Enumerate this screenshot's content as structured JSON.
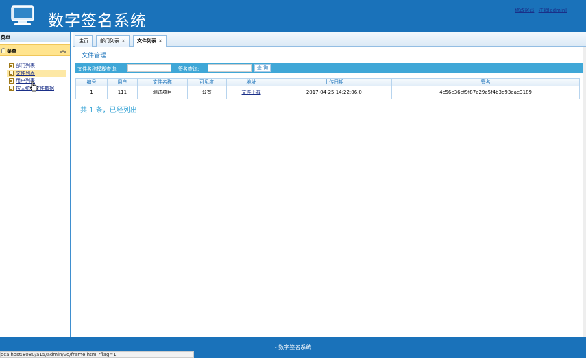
{
  "header": {
    "title": "数字签名系统",
    "links": [
      "修改密码",
      "注销[admin]"
    ]
  },
  "sidebar": {
    "top_label": "菜单",
    "group_label": "菜单",
    "items": [
      {
        "label": "部门列表",
        "active": false
      },
      {
        "label": "文件列表",
        "active": true
      },
      {
        "label": "用户列表",
        "active": false
      },
      {
        "label": "按天统计文件数据",
        "active": false
      }
    ],
    "icons": {
      "group": "lightbulb-icon",
      "collapse": "chevron-up-icon",
      "item": "document-icon"
    }
  },
  "tabs": [
    {
      "label": "主页",
      "closable": false
    },
    {
      "label": "部门列表",
      "closable": true
    },
    {
      "label": "文件列表",
      "closable": true,
      "active": true
    }
  ],
  "main": {
    "section_title": "文件管理",
    "search": {
      "file_label": "文件名称模糊查询:",
      "file_value": "",
      "sign_label": "签名查询:",
      "sign_value": "",
      "button": "查 询"
    },
    "table": {
      "headers": [
        "编号",
        "用户",
        "文件名称",
        "可见度",
        "地址",
        "上传日期",
        "签名"
      ],
      "rows": [
        [
          "1",
          "111",
          "测试项目",
          "公有",
          "文件下载",
          "2017-04-25 14:22:06.0",
          "4c56e36ef9f87a29a5f4b3d93eae3189"
        ]
      ]
    },
    "summary": "共 1 条，已经列出"
  },
  "footer": {
    "text": "- 数字签名系统"
  },
  "statusbar": {
    "url": "ocalhost:8080/a15/admin/vo/frame.html?flag=1"
  },
  "colors": {
    "header_bg": "#1a72ba",
    "search_bg": "#3fa7d7",
    "menu_group_bg": "#ffe48f"
  }
}
